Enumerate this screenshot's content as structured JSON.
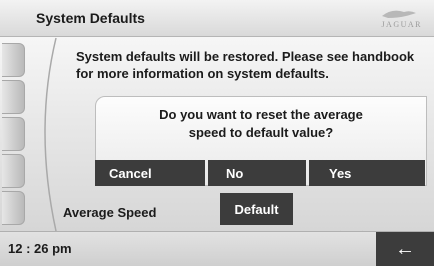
{
  "header": {
    "title": "System Defaults",
    "brand": "JAGUAR",
    "brand_icon": "jaguar-leaper-icon"
  },
  "main": {
    "message": "System defaults will be restored. Please see handbook for more information on system defaults."
  },
  "dialog": {
    "question": "Do you want to reset the average\nspeed to default value?",
    "buttons": {
      "cancel": "Cancel",
      "no": "No",
      "yes": "Yes"
    }
  },
  "setting_row": {
    "label": "Average Speed",
    "action": "Default"
  },
  "status": {
    "time": "12 : 26 pm",
    "back_icon": "←"
  },
  "colors": {
    "button_bg": "#3c3c3c",
    "button_text": "#ffffff",
    "panel_bg": "#e8e8e8"
  }
}
